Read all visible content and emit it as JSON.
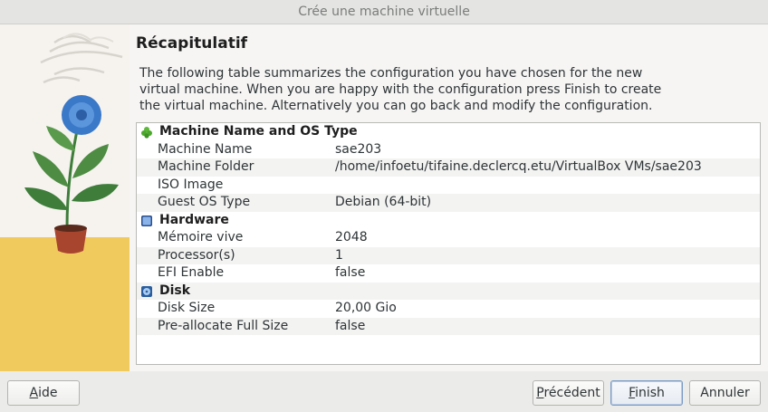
{
  "window": {
    "title": "Crée une machine virtuelle"
  },
  "page": {
    "title": "Récapitulatif",
    "description": "The following table summarizes the configuration you have chosen for the new virtual machine. When you are happy with the configuration press Finish to create the virtual machine. Alternatively you can go back and modify the configuration."
  },
  "summary": {
    "sections": [
      {
        "title": "Machine Name and OS Type",
        "icon": "puzzle-icon",
        "rows": [
          {
            "key": "Machine Name",
            "value": "sae203"
          },
          {
            "key": "Machine Folder",
            "value": "/home/infoetu/tifaine.declercq.etu/VirtualBox VMs/sae203"
          },
          {
            "key": "ISO Image",
            "value": ""
          },
          {
            "key": "Guest OS Type",
            "value": "Debian (64-bit)"
          }
        ]
      },
      {
        "title": "Hardware",
        "icon": "chip-icon",
        "rows": [
          {
            "key": "Mémoire vive",
            "value": "2048"
          },
          {
            "key": "Processor(s)",
            "value": "1"
          },
          {
            "key": "EFI Enable",
            "value": "false"
          }
        ]
      },
      {
        "title": "Disk",
        "icon": "hard-disk-icon",
        "rows": [
          {
            "key": "Disk Size",
            "value": "20,00 Gio"
          },
          {
            "key": "Pre-allocate Full Size",
            "value": "false"
          }
        ]
      }
    ]
  },
  "buttons": {
    "help": {
      "mnemonic": "A",
      "rest": "ide"
    },
    "back": {
      "mnemonic": "P",
      "rest": "récédent"
    },
    "finish": {
      "mnemonic": "F",
      "rest": "inish"
    },
    "cancel": {
      "mnemonic": "",
      "rest": "Annuler"
    }
  },
  "colors": {
    "accent": "#3a78c8",
    "wall": "#f6f3ef",
    "floor": "#f1ca5e",
    "pot": "#a8452f",
    "leaf": "#3e7d3a"
  }
}
